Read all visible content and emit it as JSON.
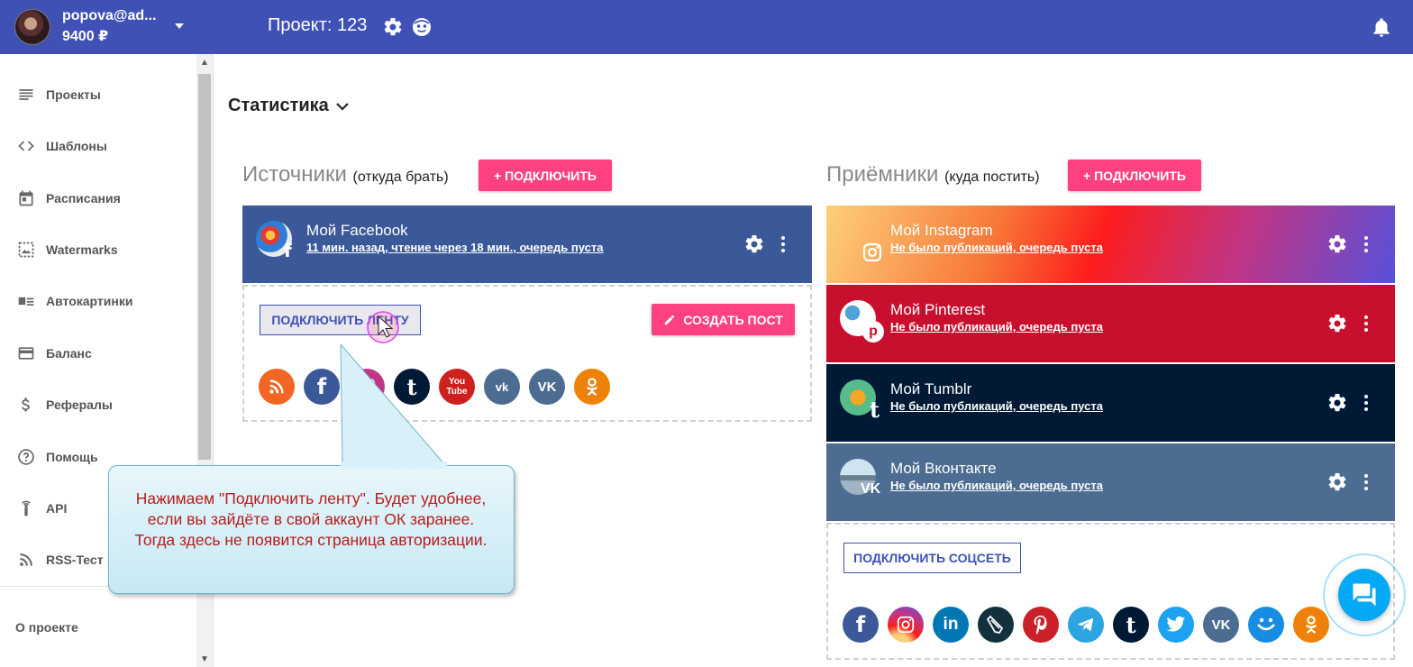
{
  "header": {
    "user_name": "popova@ad...",
    "balance": "9400 ₽",
    "project_title": "Проект: 123"
  },
  "sidebar": {
    "items": [
      {
        "label": "Проекты",
        "icon": "list-icon"
      },
      {
        "label": "Шаблоны",
        "icon": "code-icon"
      },
      {
        "label": "Расписания",
        "icon": "calendar-icon"
      },
      {
        "label": "Watermarks",
        "icon": "image-icon"
      },
      {
        "label": "Автокартинки",
        "icon": "image-text-icon"
      },
      {
        "label": "Баланс",
        "icon": "credit-card-icon"
      },
      {
        "label": "Рефералы",
        "icon": "dollar-icon"
      },
      {
        "label": "Помощь",
        "icon": "help-icon"
      },
      {
        "label": "API",
        "icon": "antenna-icon"
      },
      {
        "label": "RSS-Тест",
        "icon": "rss-icon"
      }
    ],
    "about": "О проекте"
  },
  "main": {
    "stats_label": "Статистика",
    "sources": {
      "title": "Источники",
      "subtitle": "(откуда брать)",
      "connect_label": "+ ПОДКЛЮЧИТЬ",
      "card": {
        "title": "Мой Facebook",
        "subtitle": "11 мин. назад, чтение через 18 мин., очередь пуста",
        "color": "#3b5998"
      },
      "connect_feed_label": "ПОДКЛЮЧИТЬ ЛЕНТУ",
      "create_post_label": "СОЗДАТЬ ПОСТ",
      "networks": [
        "rss",
        "facebook",
        "instagram",
        "tumblr",
        "youtube",
        "vk-rss",
        "vk",
        "odnoklassniki"
      ]
    },
    "receivers": {
      "title": "Приёмники",
      "subtitle": "(куда постить)",
      "connect_label": "+ ПОДКЛЮЧИТЬ",
      "cards": [
        {
          "title": "Мой Instagram",
          "subtitle": "Не было публикаций, очередь пуста",
          "color": "#e1306c"
        },
        {
          "title": "Мой Pinterest",
          "subtitle": "Не было публикаций, очередь пуста",
          "color": "#c8102e"
        },
        {
          "title": "Мой Tumblr",
          "subtitle": "Не было публикаций, очередь пуста",
          "color": "#001935"
        },
        {
          "title": "Мой Вконтакте",
          "subtitle": "Не было публикаций, очередь пуста",
          "color": "#4c6c91"
        }
      ],
      "connect_social_label": "ПОДКЛЮЧИТЬ СОЦСЕТЬ",
      "networks": [
        "facebook",
        "instagram",
        "linkedin",
        "livejournal",
        "pinterest",
        "telegram",
        "tumblr",
        "twitter",
        "vk",
        "moimir",
        "odnoklassniki"
      ]
    }
  },
  "callout": {
    "text": "Нажимаем \"Подключить ленту\". Будет удобнее, если вы зайдёте в свой аккаунт ОК заранее. Тогда здесь не появится страница авторизации."
  }
}
